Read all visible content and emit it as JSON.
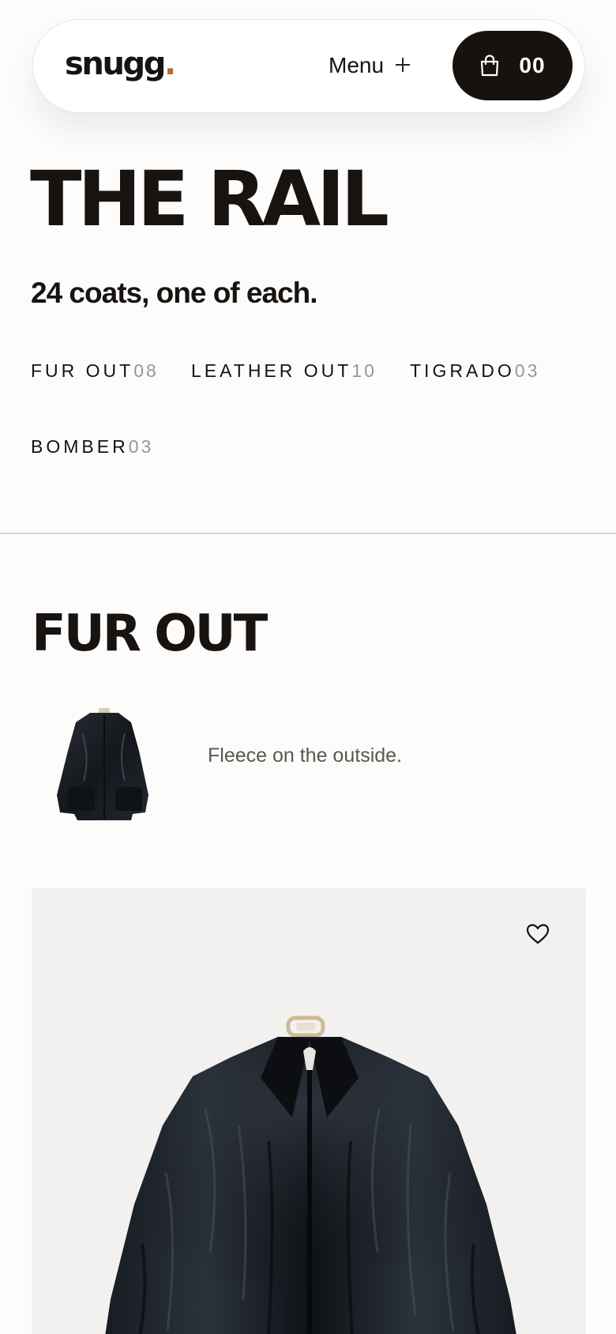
{
  "header": {
    "logo_text": "snugg",
    "logo_dot": ".",
    "menu_label": "Menu",
    "menu_icon": "plus-icon",
    "cart_icon": "shopping-bag-icon",
    "cart_count": "00"
  },
  "hero": {
    "title": "THE RAIL",
    "subtitle": "24 coats, one of each."
  },
  "categories": [
    {
      "label": "FUR OUT",
      "count": "08"
    },
    {
      "label": "LEATHER OUT",
      "count": "10"
    },
    {
      "label": "TIGRADO",
      "count": "03"
    },
    {
      "label": "BOMBER",
      "count": "03"
    }
  ],
  "section": {
    "title": "FUR OUT",
    "description": "Fleece on the outside."
  },
  "product": {
    "favorite_icon": "heart-icon"
  },
  "colors": {
    "brand_dark": "#18120f",
    "logo_accent": "#b96a2e",
    "muted_count": "#9a9692",
    "card_bg": "#f2f1ef"
  }
}
